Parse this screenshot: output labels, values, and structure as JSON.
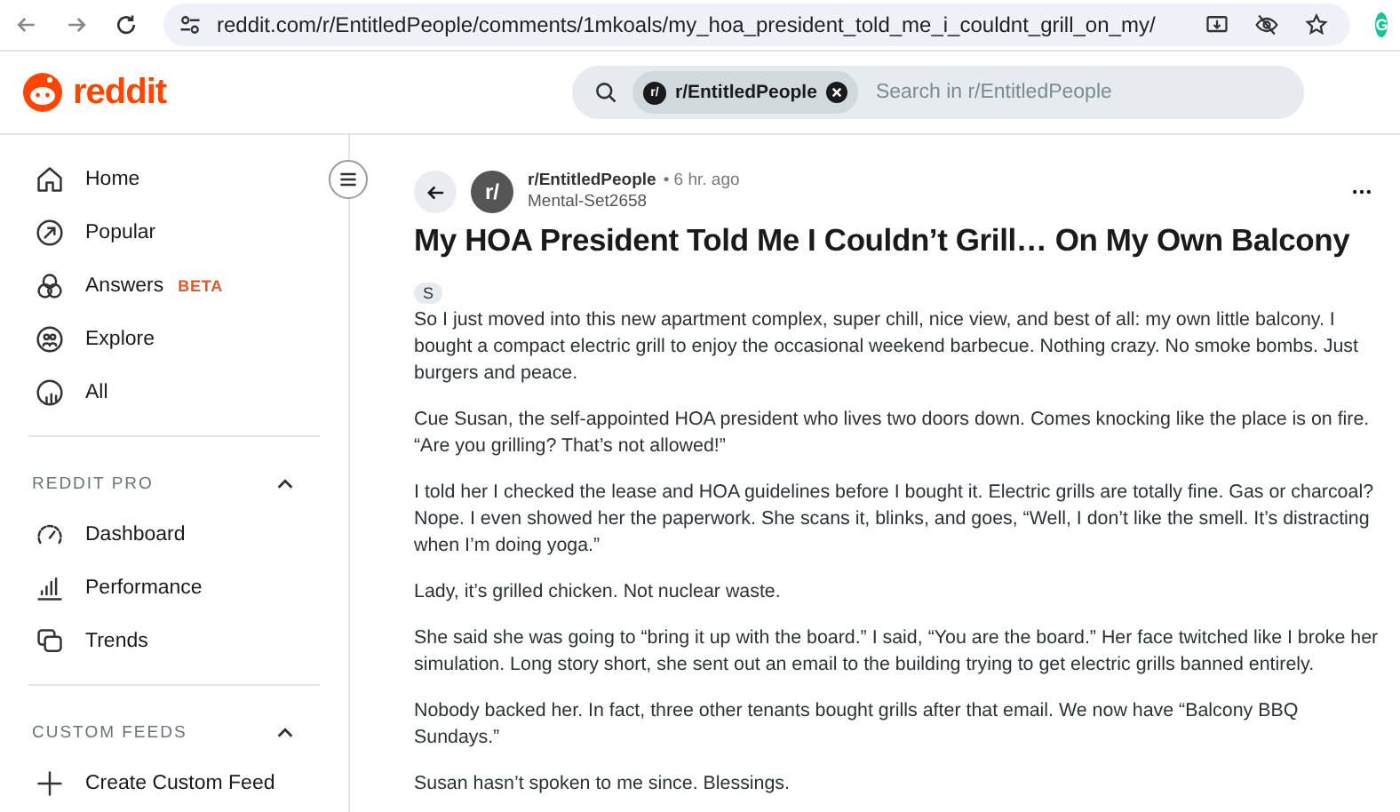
{
  "browser": {
    "url": "reddit.com/r/EntitledPeople/comments/1mkoals/my_hoa_president_told_me_i_couldnt_grill_on_my/",
    "profile_initial": "G"
  },
  "header": {
    "logo_text": "reddit",
    "search": {
      "community_chip": "r/EntitledPeople",
      "chip_icon": "r/",
      "placeholder": "Search in r/EntitledPeople"
    }
  },
  "sidebar": {
    "items": [
      {
        "label": "Home"
      },
      {
        "label": "Popular"
      },
      {
        "label": "Answers",
        "badge": "BETA"
      },
      {
        "label": "Explore"
      },
      {
        "label": "All"
      }
    ],
    "sections": [
      {
        "title": "REDDIT PRO",
        "expanded": true,
        "items": [
          {
            "label": "Dashboard"
          },
          {
            "label": "Performance"
          },
          {
            "label": "Trends"
          }
        ]
      },
      {
        "title": "CUSTOM FEEDS",
        "expanded": true,
        "items": [
          {
            "label": "Create Custom Feed"
          }
        ]
      }
    ]
  },
  "post": {
    "community": "r/EntitledPeople",
    "avatar_text": "r/",
    "time": "• 6 hr. ago",
    "author": "Mental-Set2658",
    "title": "My HOA President Told Me I Couldn’t Grill… On My Own Balcony",
    "flair": "S",
    "paragraphs": [
      "So I just moved into this new apartment complex, super chill, nice view, and best of all: my own little balcony. I bought a compact electric grill to enjoy the occasional weekend barbecue. Nothing crazy. No smoke bombs. Just burgers and peace.",
      "Cue Susan, the self-appointed HOA president who lives two doors down. Comes knocking like the place is on fire. “Are you grilling? That’s not allowed!”",
      "I told her I checked the lease and HOA guidelines before I bought it. Electric grills are totally fine. Gas or charcoal? Nope. I even showed her the paperwork. She scans it, blinks, and goes, “Well, I don’t like the smell. It’s distracting when I’m doing yoga.”",
      "Lady, it’s grilled chicken. Not nuclear waste.",
      "She said she was going to “bring it up with the board.” I said, “You are the board.” Her face twitched like I broke her simulation. Long story short, she sent out an email to the building trying to get electric grills banned entirely.",
      "Nobody backed her. In fact, three other tenants bought grills after that email. We now have “Balcony BBQ Sundays.”",
      "Susan hasn’t spoken to me since. Blessings."
    ]
  }
}
